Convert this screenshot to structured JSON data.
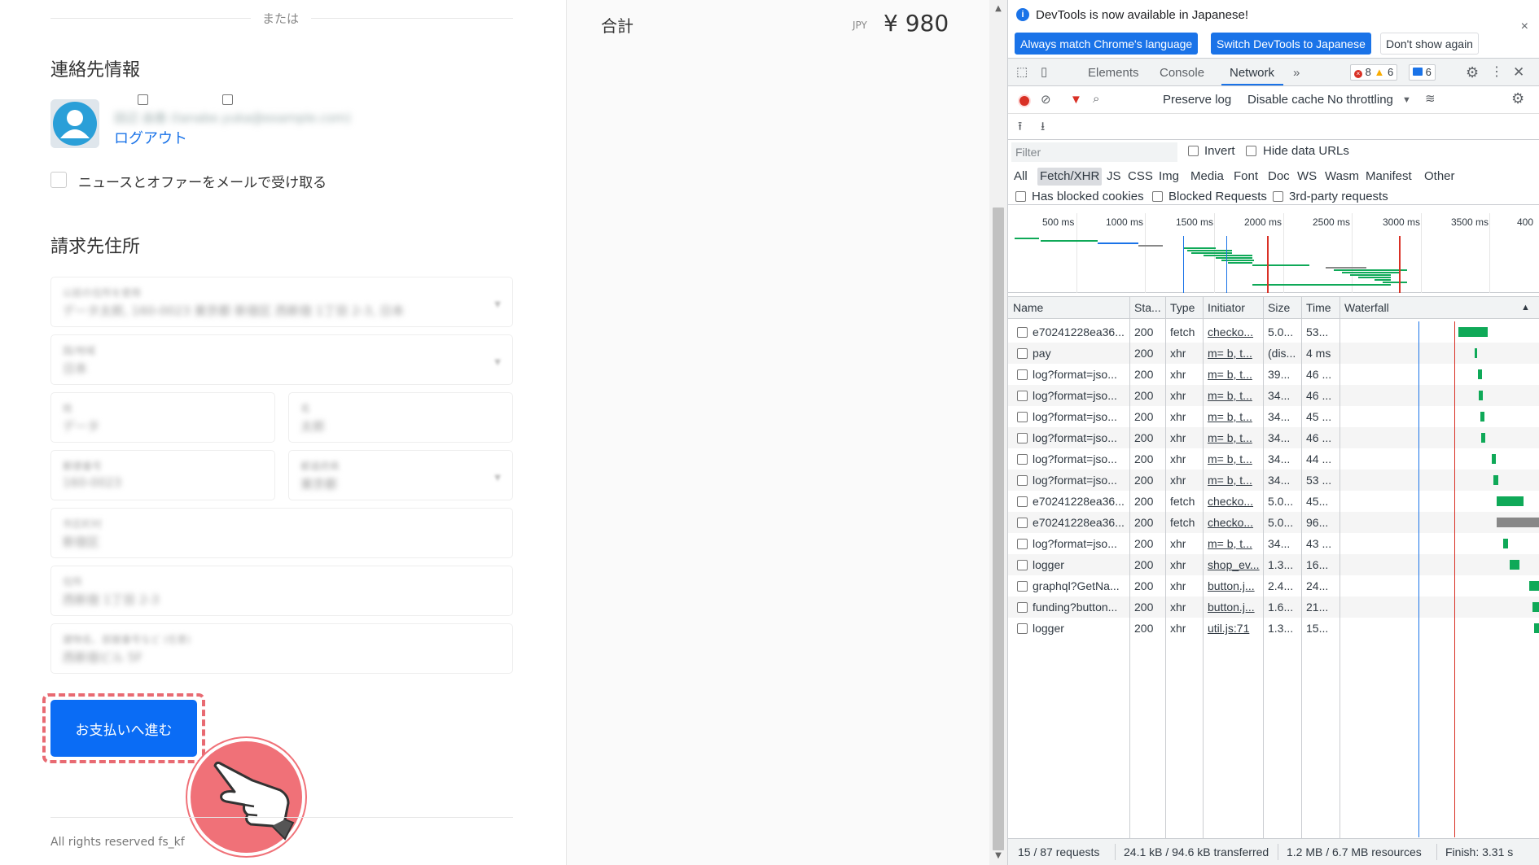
{
  "checkout": {
    "or_text": "または",
    "contact_heading": "連絡先情報",
    "account_email": "田辺 由香 (tanabe.yuka@example.com)",
    "logout_link": "ログアウト",
    "newsletter_label": "ニュースとオファーをメールで受け取る",
    "billing_heading": "請求先住所",
    "fields": [
      {
        "label": "以前の住所を使用",
        "value": "データ太郎, 160-0023 東京都 新宿区 西新宿 1丁目 2-3, 日本"
      },
      {
        "label": "国/地域",
        "value": "日本"
      },
      {
        "label": "姓",
        "value": "データ"
      },
      {
        "label": "名",
        "value": "太郎"
      },
      {
        "label": "郵便番号",
        "value": "160-0023"
      },
      {
        "label": "都道府県",
        "value": "東京都"
      },
      {
        "label": "市区町村",
        "value": "新宿区"
      },
      {
        "label": "住所",
        "value": "西新宿 1丁目 2-3"
      },
      {
        "label": "建物名、部屋番号など (任意)",
        "value": "西新宿ビル 5F"
      }
    ],
    "pay_button": "お支払いへ進む",
    "footer": "All rights reserved fs_kf"
  },
  "summary": {
    "total_label": "合計",
    "currency": "JPY",
    "total_price": "¥ 980"
  },
  "devtools": {
    "banner": {
      "text": "DevTools is now available in Japanese!",
      "btn_match": "Always match Chrome's language",
      "btn_switch": "Switch DevTools to Japanese",
      "btn_dont": "Don't show again",
      "close": "×"
    },
    "tabs": [
      "Elements",
      "Console",
      "Network"
    ],
    "more_tabs": "»",
    "errors": "8",
    "warnings": "6",
    "messages": "6",
    "toolbar": {
      "preserve_log": "Preserve log",
      "disable_cache": "Disable cache",
      "throttling": "No throttling"
    },
    "filter": {
      "placeholder": "Filter",
      "invert": "Invert",
      "hide_data_urls": "Hide data URLs",
      "types": [
        "All",
        "Fetch/XHR",
        "JS",
        "CSS",
        "Img",
        "Media",
        "Font",
        "Doc",
        "WS",
        "Wasm",
        "Manifest",
        "Other"
      ],
      "has_blocked_cookies": "Has blocked cookies",
      "blocked_requests": "Blocked Requests",
      "third_party": "3rd-party requests"
    },
    "overview_ticks": [
      "500 ms",
      "1000 ms",
      "1500 ms",
      "2000 ms",
      "2500 ms",
      "3000 ms",
      "3500 ms",
      "400"
    ],
    "columns": [
      "Name",
      "Sta...",
      "Type",
      "Initiator",
      "Size",
      "Time",
      "Waterfall"
    ],
    "sort_arrow": "▲",
    "rows": [
      {
        "name": "e70241228ea36...",
        "status": "200",
        "type": "fetch",
        "initiator": "checko...",
        "size": "5.0...",
        "time": "53..."
      },
      {
        "name": "pay",
        "status": "200",
        "type": "xhr",
        "initiator": "m= b, t...",
        "size": "(dis...",
        "time": "4 ms"
      },
      {
        "name": "log?format=jso...",
        "status": "200",
        "type": "xhr",
        "initiator": "m= b, t...",
        "size": "39...",
        "time": "46 ..."
      },
      {
        "name": "log?format=jso...",
        "status": "200",
        "type": "xhr",
        "initiator": "m= b, t...",
        "size": "34...",
        "time": "46 ..."
      },
      {
        "name": "log?format=jso...",
        "status": "200",
        "type": "xhr",
        "initiator": "m= b, t...",
        "size": "34...",
        "time": "45 ..."
      },
      {
        "name": "log?format=jso...",
        "status": "200",
        "type": "xhr",
        "initiator": "m= b, t...",
        "size": "34...",
        "time": "46 ..."
      },
      {
        "name": "log?format=jso...",
        "status": "200",
        "type": "xhr",
        "initiator": "m= b, t...",
        "size": "34...",
        "time": "44 ..."
      },
      {
        "name": "log?format=jso...",
        "status": "200",
        "type": "xhr",
        "initiator": "m= b, t...",
        "size": "34...",
        "time": "53 ..."
      },
      {
        "name": "e70241228ea36...",
        "status": "200",
        "type": "fetch",
        "initiator": "checko...",
        "size": "5.0...",
        "time": "45..."
      },
      {
        "name": "e70241228ea36...",
        "status": "200",
        "type": "fetch",
        "initiator": "checko...",
        "size": "5.0...",
        "time": "96..."
      },
      {
        "name": "log?format=jso...",
        "status": "200",
        "type": "xhr",
        "initiator": "m= b, t...",
        "size": "34...",
        "time": "43 ..."
      },
      {
        "name": "logger",
        "status": "200",
        "type": "xhr",
        "initiator": "shop_ev...",
        "size": "1.3...",
        "time": "16..."
      },
      {
        "name": "graphql?GetNa...",
        "status": "200",
        "type": "xhr",
        "initiator": "button.j...",
        "size": "2.4...",
        "time": "24..."
      },
      {
        "name": "funding?button...",
        "status": "200",
        "type": "xhr",
        "initiator": "button.j...",
        "size": "1.6...",
        "time": "21..."
      },
      {
        "name": "logger",
        "status": "200",
        "type": "xhr",
        "initiator": "util.js:71",
        "size": "1.3...",
        "time": "15..."
      }
    ],
    "status_bar": {
      "requests": "15 / 87 requests",
      "transferred": "24.1 kB / 94.6 kB transferred",
      "resources": "1.2 MB / 6.7 MB resources",
      "finish": "Finish: 3.31 s"
    },
    "colors": {
      "accent": "#1a73e8",
      "record": "#d93025",
      "waterfall_green": "#0fa958"
    }
  }
}
